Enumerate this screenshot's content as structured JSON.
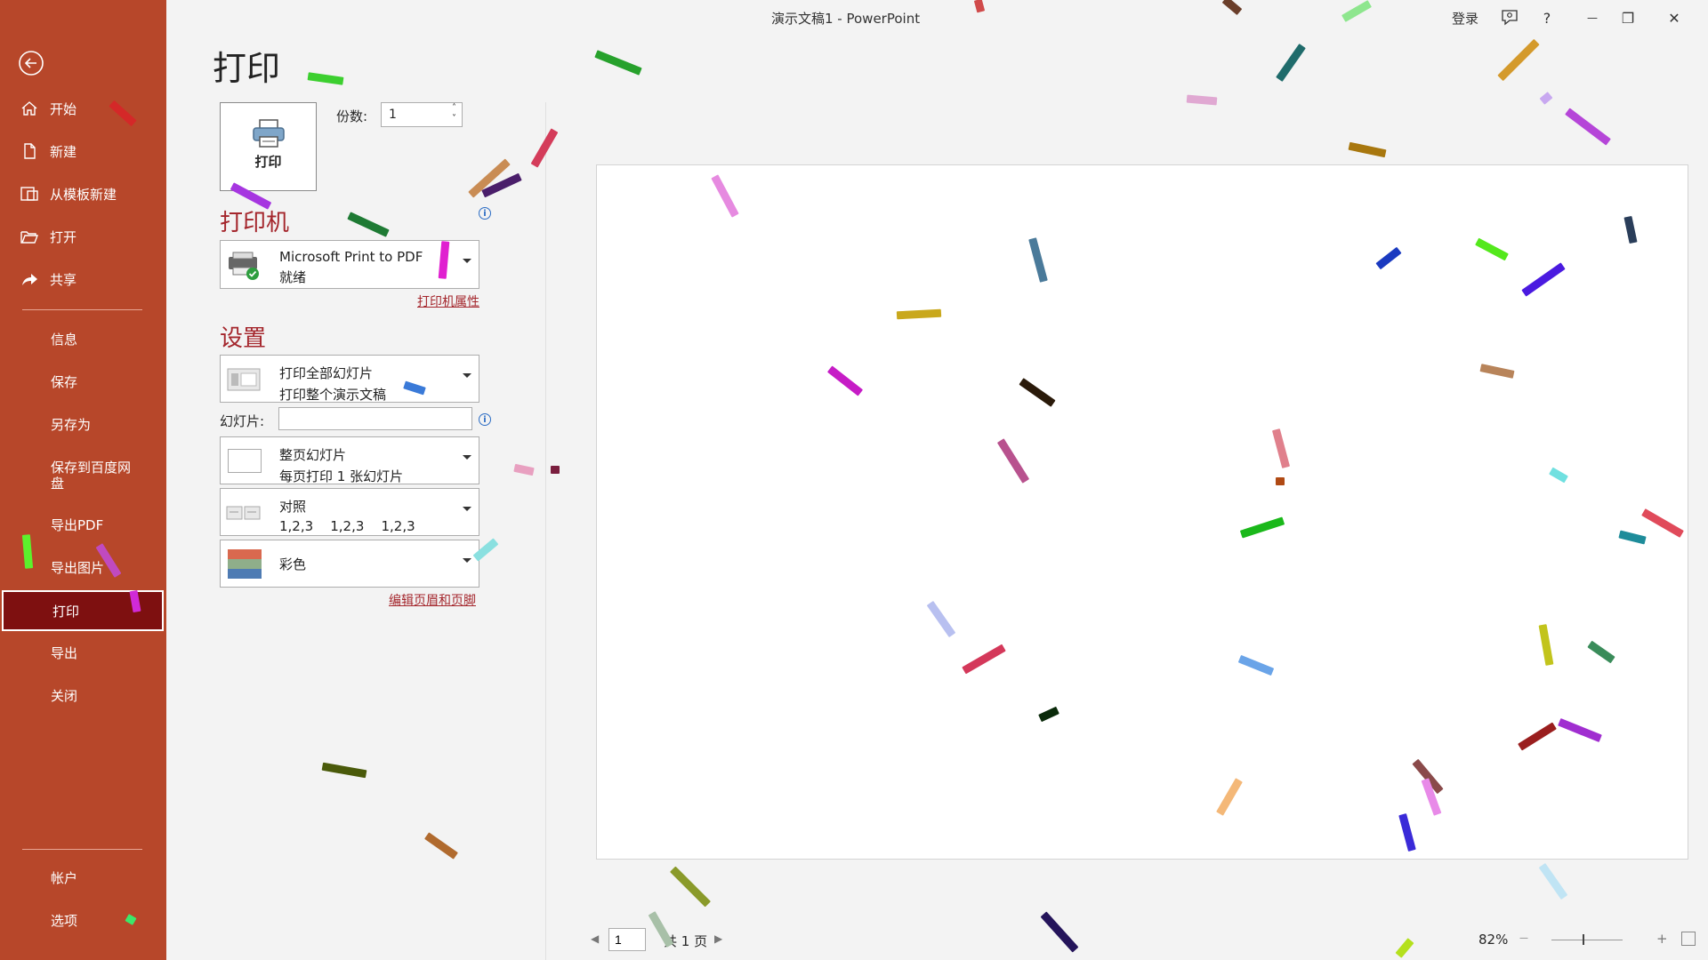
{
  "window": {
    "title": "演示文稿1  -  PowerPoint",
    "signin": "登录",
    "help": "?",
    "minimize": "—",
    "restore": "❐",
    "close": "✕"
  },
  "sidebar": {
    "back_icon": "back-arrow-icon",
    "items": [
      {
        "label": "开始",
        "icon": "home-icon"
      },
      {
        "label": "新建",
        "icon": "new-doc-icon"
      },
      {
        "label": "从模板新建",
        "icon": "template-icon"
      },
      {
        "label": "打开",
        "icon": "open-folder-icon"
      },
      {
        "label": "共享",
        "icon": "share-icon"
      },
      {
        "label": "信息"
      },
      {
        "label": "保存"
      },
      {
        "label": "另存为"
      },
      {
        "label": "保存到百度网盘"
      },
      {
        "label": "导出PDF"
      },
      {
        "label": "导出图片"
      },
      {
        "label": "打印",
        "selected": true
      },
      {
        "label": "导出"
      },
      {
        "label": "关闭"
      },
      {
        "label": "帐户"
      },
      {
        "label": "选项"
      }
    ]
  },
  "print": {
    "title": "打印",
    "print_button": "打印",
    "copies_label": "份数:",
    "copies_value": "1",
    "printer_heading": "打印机",
    "printer_name": "Microsoft Print to PDF",
    "printer_status": "就绪",
    "printer_properties": "打印机属性",
    "settings_heading": "设置",
    "range_line1": "打印全部幻灯片",
    "range_line2": "打印整个演示文稿",
    "slides_label": "幻灯片:",
    "slides_value": "",
    "layout_line1": "整页幻灯片",
    "layout_line2": "每页打印 1 张幻灯片",
    "collate_line1": "对照",
    "collate_line2": "1,2,3    1,2,3    1,2,3",
    "color_line1": "彩色",
    "edit_header_footer": "编辑页眉和页脚"
  },
  "preview": {
    "page_value": "1",
    "page_total": "共 1 页",
    "zoom": "82%",
    "zoom_minus": "—",
    "zoom_plus": "+"
  },
  "colors": {
    "sidebar_bg": "#b7472a",
    "selected_bg": "#7e1010",
    "accent_red": "#a4262c"
  }
}
